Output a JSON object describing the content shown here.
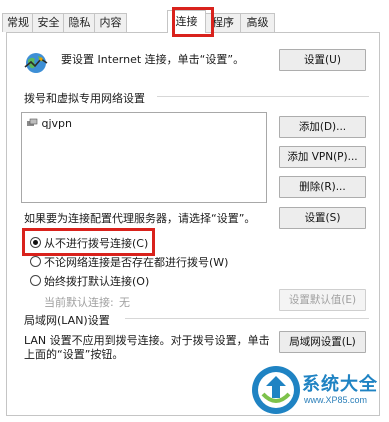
{
  "tabs": [
    "常规",
    "安全",
    "隐私",
    "内容",
    "连接",
    "程序",
    "高级"
  ],
  "active_tab": "连接",
  "setup": {
    "text": "要设置 Internet 连接，单击“设置”。",
    "button": "设置(U)"
  },
  "dialup": {
    "section_label": "拨号和虚拟专用网络设置",
    "entries": [
      "qjvpn"
    ],
    "add_button": "添加(D)...",
    "add_vpn_button": "添加 VPN(P)...",
    "remove_button": "删除(R)...",
    "proxy_hint": "如果要为连接配置代理服务器，请选择“设置”。",
    "settings_button": "设置(S)",
    "options": [
      "从不进行拨号连接(C)",
      "不论网络连接是否存在都进行拨号(W)",
      "始终拨打默认连接(O)"
    ],
    "selected_index": 0,
    "current_default_label": "当前默认连接:",
    "current_default_value": "无",
    "set_default_button": "设置默认值(E)"
  },
  "lan": {
    "section_label": "局域网(LAN)设置",
    "text_line1": "LAN 设置不应用到拨号连接。对于拨号设置，单击",
    "text_line2": "上面的“设置”按钮。",
    "button": "局域网设置(L)"
  },
  "watermark": {
    "title": "系统大全",
    "url": "www.XP85.com"
  },
  "colors": {
    "highlight": "#d9221c",
    "watermark": "#1f83c3"
  }
}
